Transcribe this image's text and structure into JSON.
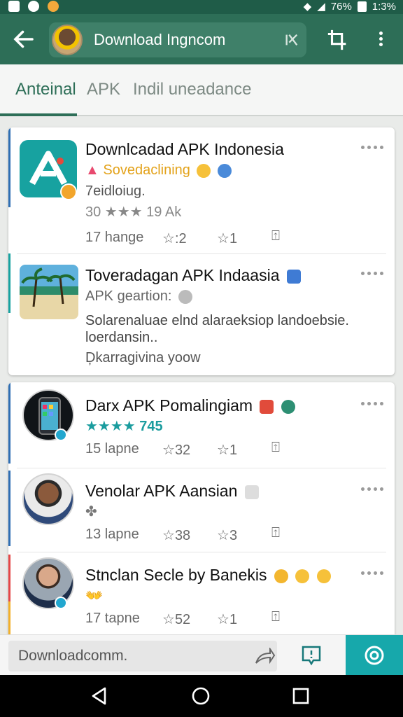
{
  "status_bar": {
    "battery": "76%",
    "time": "1:3%"
  },
  "app_bar": {
    "search_text": "Download Ingncom"
  },
  "tabs": [
    {
      "label": "Anteinal",
      "active": true
    },
    {
      "label": "APK",
      "active": false
    },
    {
      "label": "Indil uneadance",
      "active": false
    }
  ],
  "card1": {
    "item1": {
      "title": "Downlcadad APK Indonesia",
      "subtitle": "Sovedaclining",
      "meta": "7eidloiug.",
      "rating_line": "30 ★★★ 19 Ak",
      "stat_label": "17 hange",
      "stat_likes": ":2",
      "stat_share": "1"
    },
    "item2": {
      "title": "Toveradagan APK Indaasia",
      "subtitle": "APK geartion:",
      "description": "Solarenaluae elnd alaraeksiop landoebsie. loerdansin..",
      "footer": "Ḑkarragivina yoow"
    }
  },
  "feed": [
    {
      "title": "Darx APK Pomalingiam",
      "rating": "★★★★ 745",
      "stat_label": "15 lapne",
      "stat_likes": "32",
      "stat_share": "1"
    },
    {
      "title": "Venolar APK Aansian",
      "subtitle": "✤",
      "stat_label": "13 lapne",
      "stat_likes": "38",
      "stat_share": "3"
    },
    {
      "title": "Stnclan Secle by Banekis",
      "subtitle": "👐",
      "stat_label": "17 tapne",
      "stat_likes": "52",
      "stat_share": "1"
    }
  ],
  "bottom_bar": {
    "comment_text": "Downloadcomm."
  },
  "colors": {
    "appbar": "#2d6e57",
    "accent_teal": "#17a8ab",
    "star_teal": "#1a9c9e",
    "star_gray": "#9a9a9a",
    "yellow_text": "#e3a21a"
  }
}
